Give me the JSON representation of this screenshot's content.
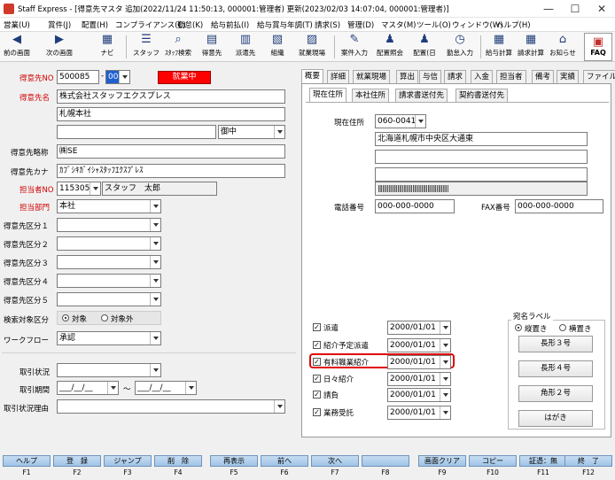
{
  "window": {
    "title": "Staff Express - [得意先マスタ 追加(2022/11/24 11:50:13, 000001:管理者) 更新(2023/02/03 14:07:04, 000001:管理者)]",
    "minimize": "—",
    "maximize": "☐",
    "close": "✕"
  },
  "menu": [
    "営業(U)",
    "賞件(J)",
    "配置(H)",
    "コンプライアンス(C)",
    "勤怠(K)",
    "給与前払(I)",
    "給与賞与年調(T)",
    "請求(S)",
    "管理(D)",
    "マスタ(M)",
    "ツール(O)",
    "ウィンドウ(W)",
    "ヘルプ(H)"
  ],
  "toolbar": {
    "back": "前の画面",
    "next": "次の画面",
    "navi": "ナビ",
    "staff": "スタッフ",
    "staff_search": "ｽﾀｯﾌ検索",
    "tokuisaki": "得意先",
    "haken": "派遣先",
    "soshiki": "組織",
    "shugyo": "就業現場",
    "anken": "案件入力",
    "haichi_shokai": "配置照会",
    "haichi_day": "配置(日",
    "kintai": "勤怠入力",
    "kyuyo": "給与計算",
    "seikyu": "請求計算",
    "oshirase": "お知らせ",
    "faq": "FAQ"
  },
  "form": {
    "code_label": "得意先NO",
    "code": "500085",
    "branch": "000",
    "status": "就業中",
    "name_label": "得意先名",
    "name1": "株式会社スタッフエクスプレス",
    "name2": "札幌本社",
    "name3": "",
    "honorific": "御中",
    "short_label": "得意先略称",
    "short": "㈱SE",
    "kana_label": "得意先カナ",
    "kana": "ｶﾌﾞｼｷｶﾞｲｼｬｽﾀｯﾌｴｸｽﾌﾟﾚｽ",
    "tanto_label": "担当者NO",
    "tanto_no": "115305",
    "tanto_name": "スタッフ　太郎",
    "dept_label": "担当部門",
    "dept": "本社",
    "kubun": [
      "得意先区分１",
      "得意先区分２",
      "得意先区分３",
      "得意先区分４",
      "得意先区分５"
    ],
    "search_label": "検索対象区分",
    "search_on": "対象",
    "search_off": "対象外",
    "workflow_label": "ワークフロー",
    "workflow": "承認",
    "torihiki_label": "取引状況",
    "period_label": "取引期間",
    "period_from": "___/__/__",
    "period_sep": "～",
    "period_to": "___/__/__",
    "reason_label": "取引状況理由"
  },
  "tabs": [
    "概要",
    "詳細",
    "就業現場",
    "算出",
    "与信",
    "請求",
    "入金",
    "担当者",
    "備考",
    "実績",
    "ファイル"
  ],
  "subtabs": [
    "現在住所",
    "本社住所",
    "請求書送付先",
    "契約書送付先"
  ],
  "address": {
    "zip_label": "現在住所",
    "zip": "060-0041",
    "addr1": "北海道札幌市中央区大通東",
    "addr2": "",
    "addr3": "",
    "addr4": "",
    "barcode": "|||||||||||||||||||||||||||||||||||||||||||||||",
    "tel_label": "電話番号",
    "tel": "000-000-0000",
    "fax_label": "FAX番号",
    "fax": "000-000-0000"
  },
  "contracts": [
    {
      "label": "派遣",
      "date": "2000/01/01"
    },
    {
      "label": "紹介予定派遣",
      "date": "2000/01/01"
    },
    {
      "label": "有料職業紹介",
      "date": "2000/01/01"
    },
    {
      "label": "日々紹介",
      "date": "2000/01/01"
    },
    {
      "label": "請負",
      "date": "2000/01/01"
    },
    {
      "label": "業務受託",
      "date": "2000/01/01"
    }
  ],
  "label_print": {
    "title": "宛名ラベル",
    "vertical": "縦置き",
    "horizontal": "横置き",
    "buttons": [
      "長形３号",
      "長形４号",
      "角形２号",
      "はがき"
    ]
  },
  "fkeys": [
    {
      "label": "ヘルプ",
      "key": "F1"
    },
    {
      "label": "登　録",
      "key": "F2"
    },
    {
      "label": "ジャンプ",
      "key": "F3"
    },
    {
      "label": "削　除",
      "key": "F4"
    },
    {
      "label": "再表示",
      "key": "F5"
    },
    {
      "label": "前へ",
      "key": "F6"
    },
    {
      "label": "次へ",
      "key": "F7"
    },
    {
      "label": "",
      "key": "F8"
    },
    {
      "label": "画面クリア",
      "key": "F9"
    },
    {
      "label": "コピー",
      "key": "F10"
    },
    {
      "label": "証憑：無",
      "key": "F11"
    },
    {
      "label": "終　了",
      "key": "F12"
    }
  ],
  "colors": {
    "status_bg": "#ff0000",
    "highlight": "#e00000",
    "fkey": "#a9cbeb"
  }
}
